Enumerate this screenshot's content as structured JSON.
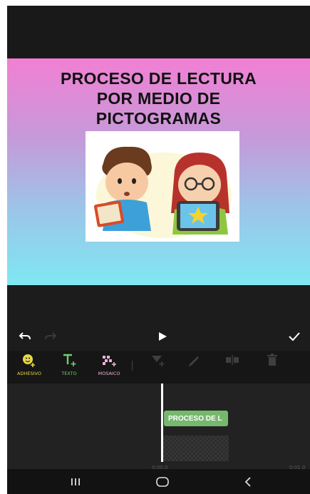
{
  "canvas": {
    "title": "PROCESO DE LECTURA\nPOR MEDIO DE\nPICTOGRAMAS",
    "image_icon": "children-reading-pictogram"
  },
  "controls": {
    "undo_icon": "undo-icon",
    "redo_icon": "redo-icon",
    "play_icon": "play-icon",
    "confirm_icon": "check-icon"
  },
  "toolbar": {
    "items": [
      {
        "label": "ADHESIVO",
        "icon": "sticker-icon",
        "state": "active"
      },
      {
        "label": "TEXTO",
        "icon": "text-add-icon",
        "state": "active"
      },
      {
        "label": "MOSAICO",
        "icon": "mosaic-icon",
        "state": "active"
      },
      {
        "label": "",
        "icon": "filter-icon",
        "state": "disabled"
      },
      {
        "label": "",
        "icon": "edit-icon",
        "state": "disabled"
      },
      {
        "label": "",
        "icon": "split-icon",
        "state": "disabled"
      },
      {
        "label": "",
        "icon": "delete-icon",
        "state": "disabled"
      }
    ]
  },
  "timeline": {
    "clip_label": "PROCESO DE L",
    "time_start": "0:00.0",
    "time_end": "0:01.0"
  },
  "navbar": {
    "recent_icon": "recent-apps-icon",
    "home_icon": "home-icon",
    "back_icon": "back-icon"
  },
  "colors": {
    "accent_yellow": "#e6d84a",
    "accent_green": "#6fd06f",
    "clip_green": "#76b86e",
    "gradient_top": "#f27fd4",
    "gradient_bottom": "#7ee8f2"
  }
}
